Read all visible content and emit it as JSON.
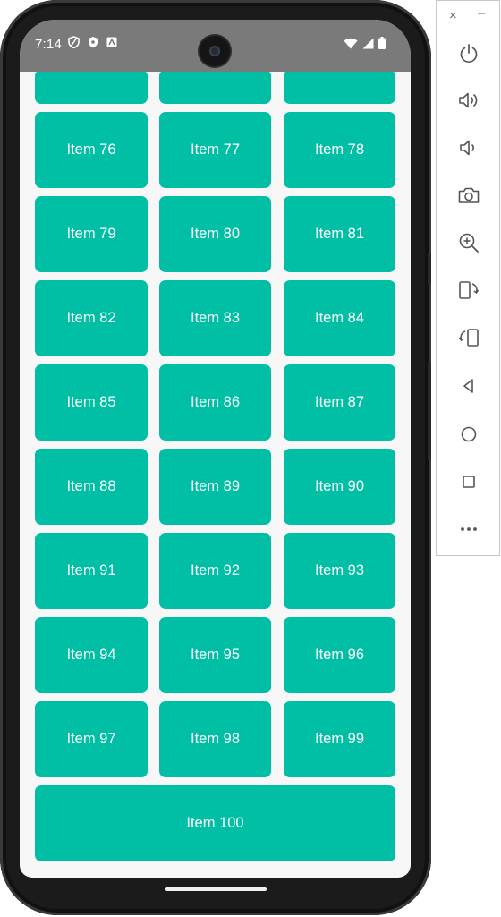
{
  "status_bar": {
    "time": "7:14",
    "left_icons": [
      "vpn-shield-icon",
      "security-shield-icon",
      "app-notification-icon"
    ],
    "right_icons": [
      "wifi-icon",
      "cell-signal-icon",
      "battery-icon"
    ]
  },
  "grid": {
    "tile_color": "#00bfa5",
    "partial_top_row": [
      "",
      "",
      ""
    ],
    "items": [
      "Item 76",
      "Item 77",
      "Item 78",
      "Item 79",
      "Item 80",
      "Item 81",
      "Item 82",
      "Item 83",
      "Item 84",
      "Item 85",
      "Item 86",
      "Item 87",
      "Item 88",
      "Item 89",
      "Item 90",
      "Item 91",
      "Item 92",
      "Item 93",
      "Item 94",
      "Item 95",
      "Item 96",
      "Item 97",
      "Item 98",
      "Item 99",
      "Item 100"
    ]
  },
  "emulator_toolbar": {
    "close_label": "×",
    "minimize_label": "–",
    "buttons": [
      {
        "name": "power-icon"
      },
      {
        "name": "volume-up-icon"
      },
      {
        "name": "volume-down-icon"
      },
      {
        "name": "camera-icon"
      },
      {
        "name": "zoom-icon"
      },
      {
        "name": "rotate-left-icon"
      },
      {
        "name": "rotate-right-icon"
      },
      {
        "name": "back-icon"
      },
      {
        "name": "home-icon"
      },
      {
        "name": "overview-icon"
      },
      {
        "name": "more-icon"
      }
    ]
  }
}
